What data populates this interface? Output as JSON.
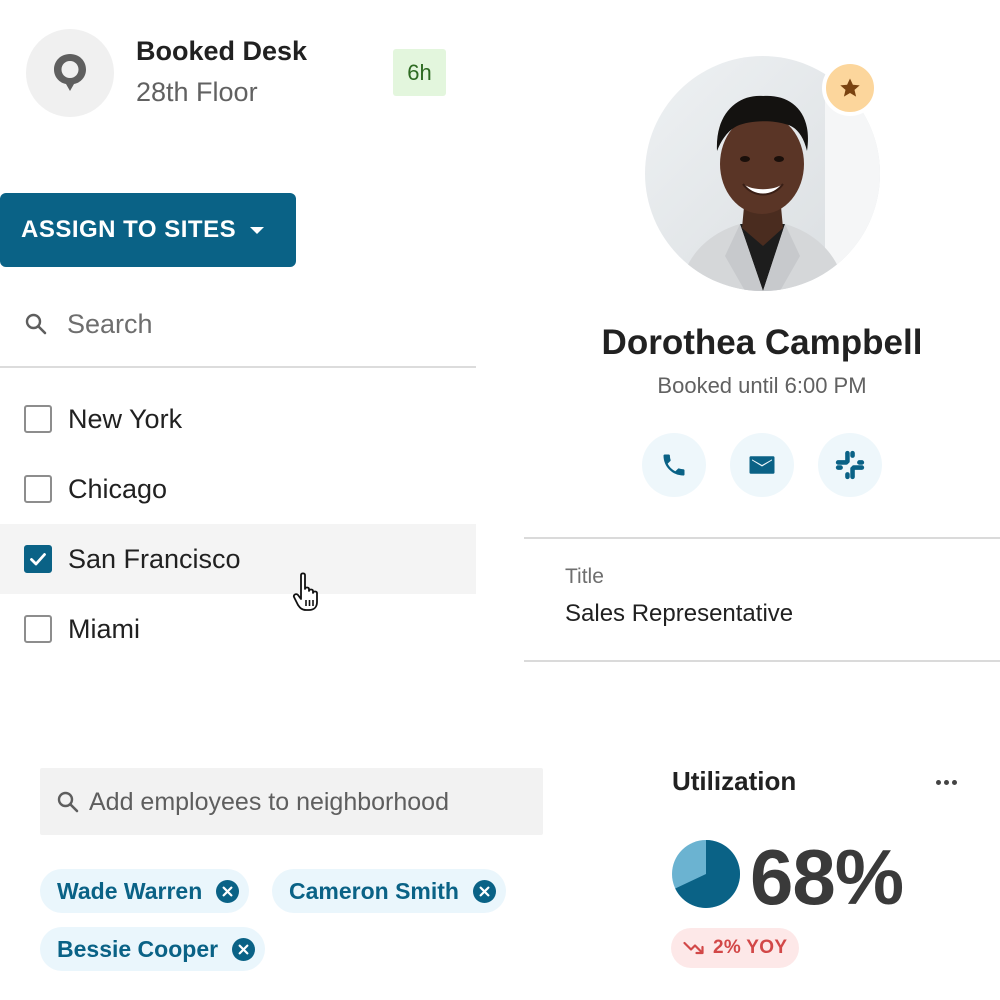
{
  "desk": {
    "title": "Booked Desk",
    "floor": "28th Floor",
    "duration": "6h",
    "icon": "location-pin-icon"
  },
  "sites": {
    "assign_button": "ASSIGN TO SITES",
    "search_placeholder": "Search",
    "items": [
      {
        "label": "New York",
        "checked": false
      },
      {
        "label": "Chicago",
        "checked": false
      },
      {
        "label": "San Francisco",
        "checked": true
      },
      {
        "label": "Miami",
        "checked": false
      }
    ]
  },
  "profile": {
    "name": "Dorothea Campbell",
    "status": "Booked until 6:00 PM",
    "favorite": true,
    "actions": [
      "phone-icon",
      "email-icon",
      "slack-icon"
    ],
    "field_label": "Title",
    "field_value": "Sales Representative"
  },
  "neighborhood": {
    "search_placeholder": "Add employees to neighborhood",
    "chips": [
      "Wade Warren",
      "Cameron Smith",
      "Bessie Cooper"
    ]
  },
  "utilization": {
    "title": "Utilization",
    "value": "68%",
    "fraction": 0.68,
    "trend": "2% YOY",
    "trend_direction": "down"
  },
  "colors": {
    "primary": "#0a6286",
    "badge_green_bg": "#e3f6dd",
    "badge_green_text": "#2e6b22",
    "chip_bg": "#eaf6fc",
    "trend_red": "#d24848",
    "trend_red_bg": "#fde8e8",
    "star_bg": "#fcd69c"
  }
}
